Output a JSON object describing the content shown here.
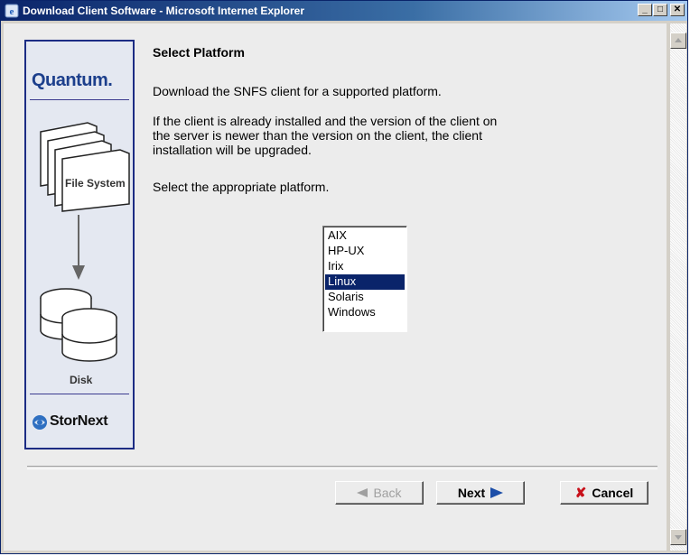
{
  "window": {
    "title": "Download Client Software - Microsoft Internet Explorer"
  },
  "sidebar": {
    "brand": "Quantum.",
    "file_system_label": "File System",
    "disk_label": "Disk",
    "product": "StorNext"
  },
  "content": {
    "heading": "Select Platform",
    "intro": "Download the SNFS client for a supported platform.",
    "upgrade_line1": "If the client is already installed and the version of the client on",
    "upgrade_line2": "the server is newer than the version on the client, the client",
    "upgrade_line3": "installation will be upgraded.",
    "instruction": "Select the appropriate platform."
  },
  "platforms": {
    "options": [
      "AIX",
      "HP-UX",
      "Irix",
      "Linux",
      "Solaris",
      "Windows"
    ],
    "selected": "Linux"
  },
  "buttons": {
    "back": "Back",
    "next": "Next",
    "cancel": "Cancel"
  }
}
